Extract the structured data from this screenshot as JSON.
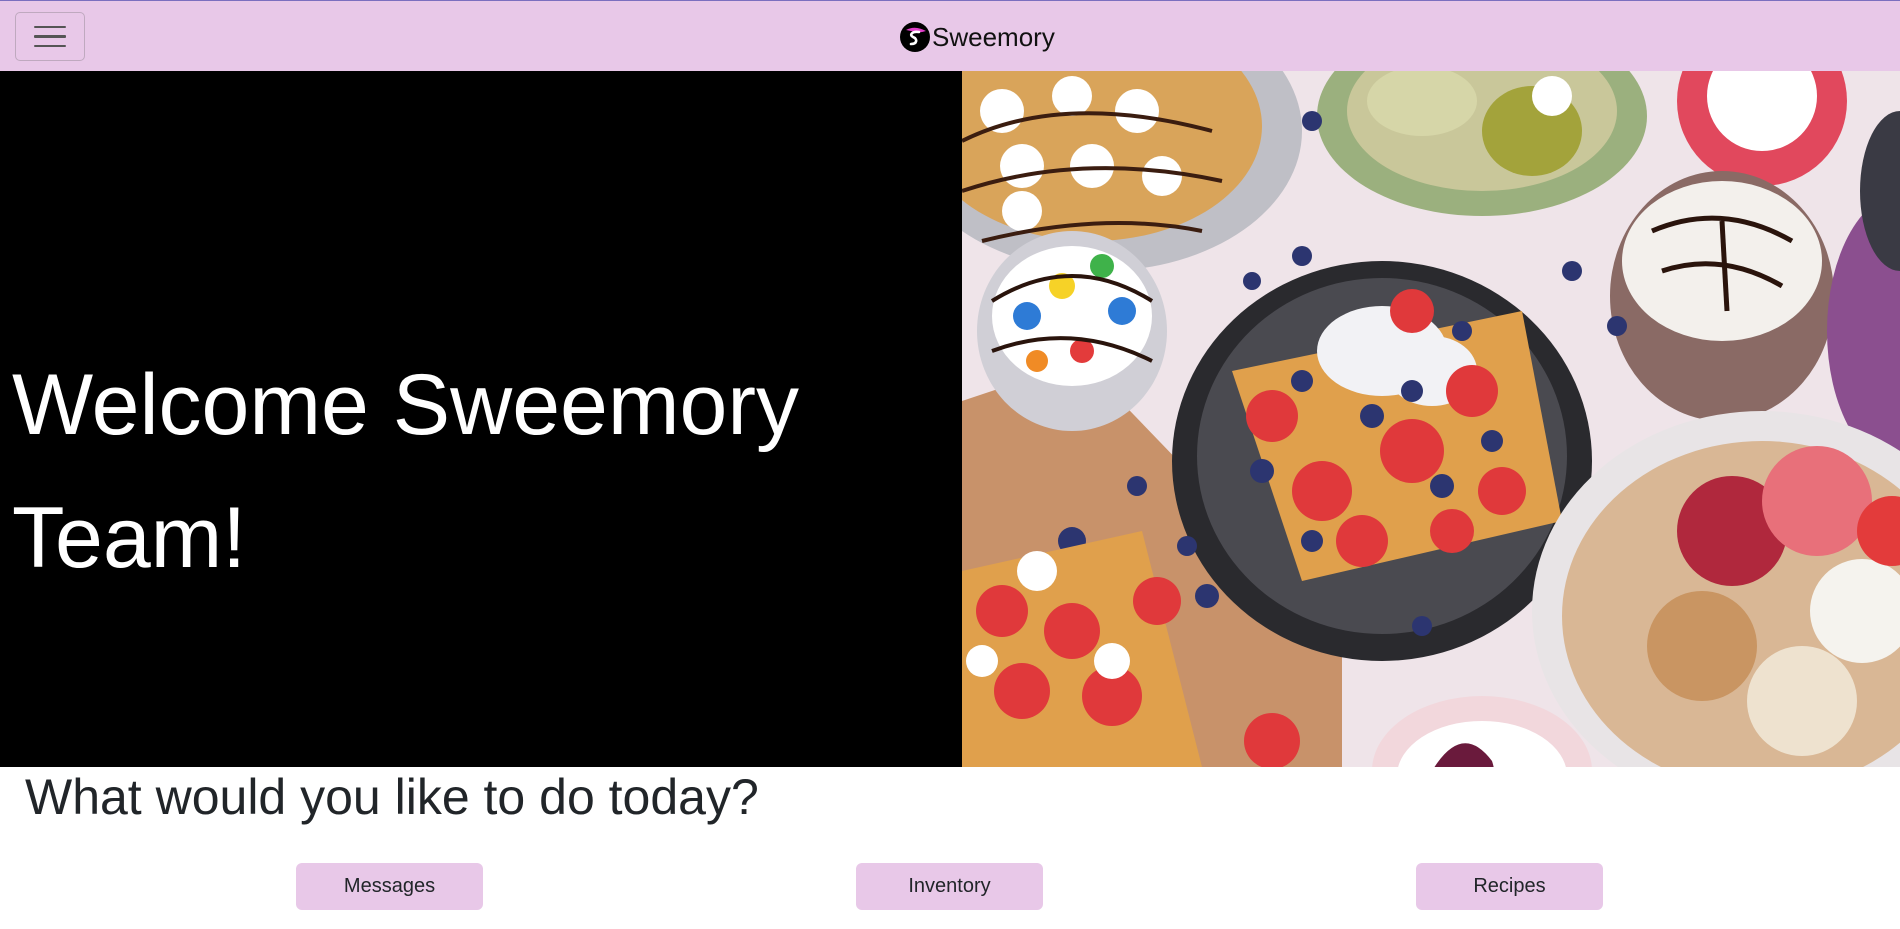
{
  "navbar": {
    "brand_name": "Sweemory",
    "background_color": "#e8c8e8",
    "toggle_icon": "hamburger-menu-icon",
    "logo_icon": "sweemory-logo-icon"
  },
  "hero": {
    "title": "Welcome Sweemory Team!",
    "image_description_icon": "desserts-photo"
  },
  "main": {
    "prompt": "What would you like to do today?",
    "actions": [
      {
        "label": "Messages"
      },
      {
        "label": "Inventory"
      },
      {
        "label": "Recipes"
      }
    ],
    "button_color": "#e8c8e8"
  }
}
